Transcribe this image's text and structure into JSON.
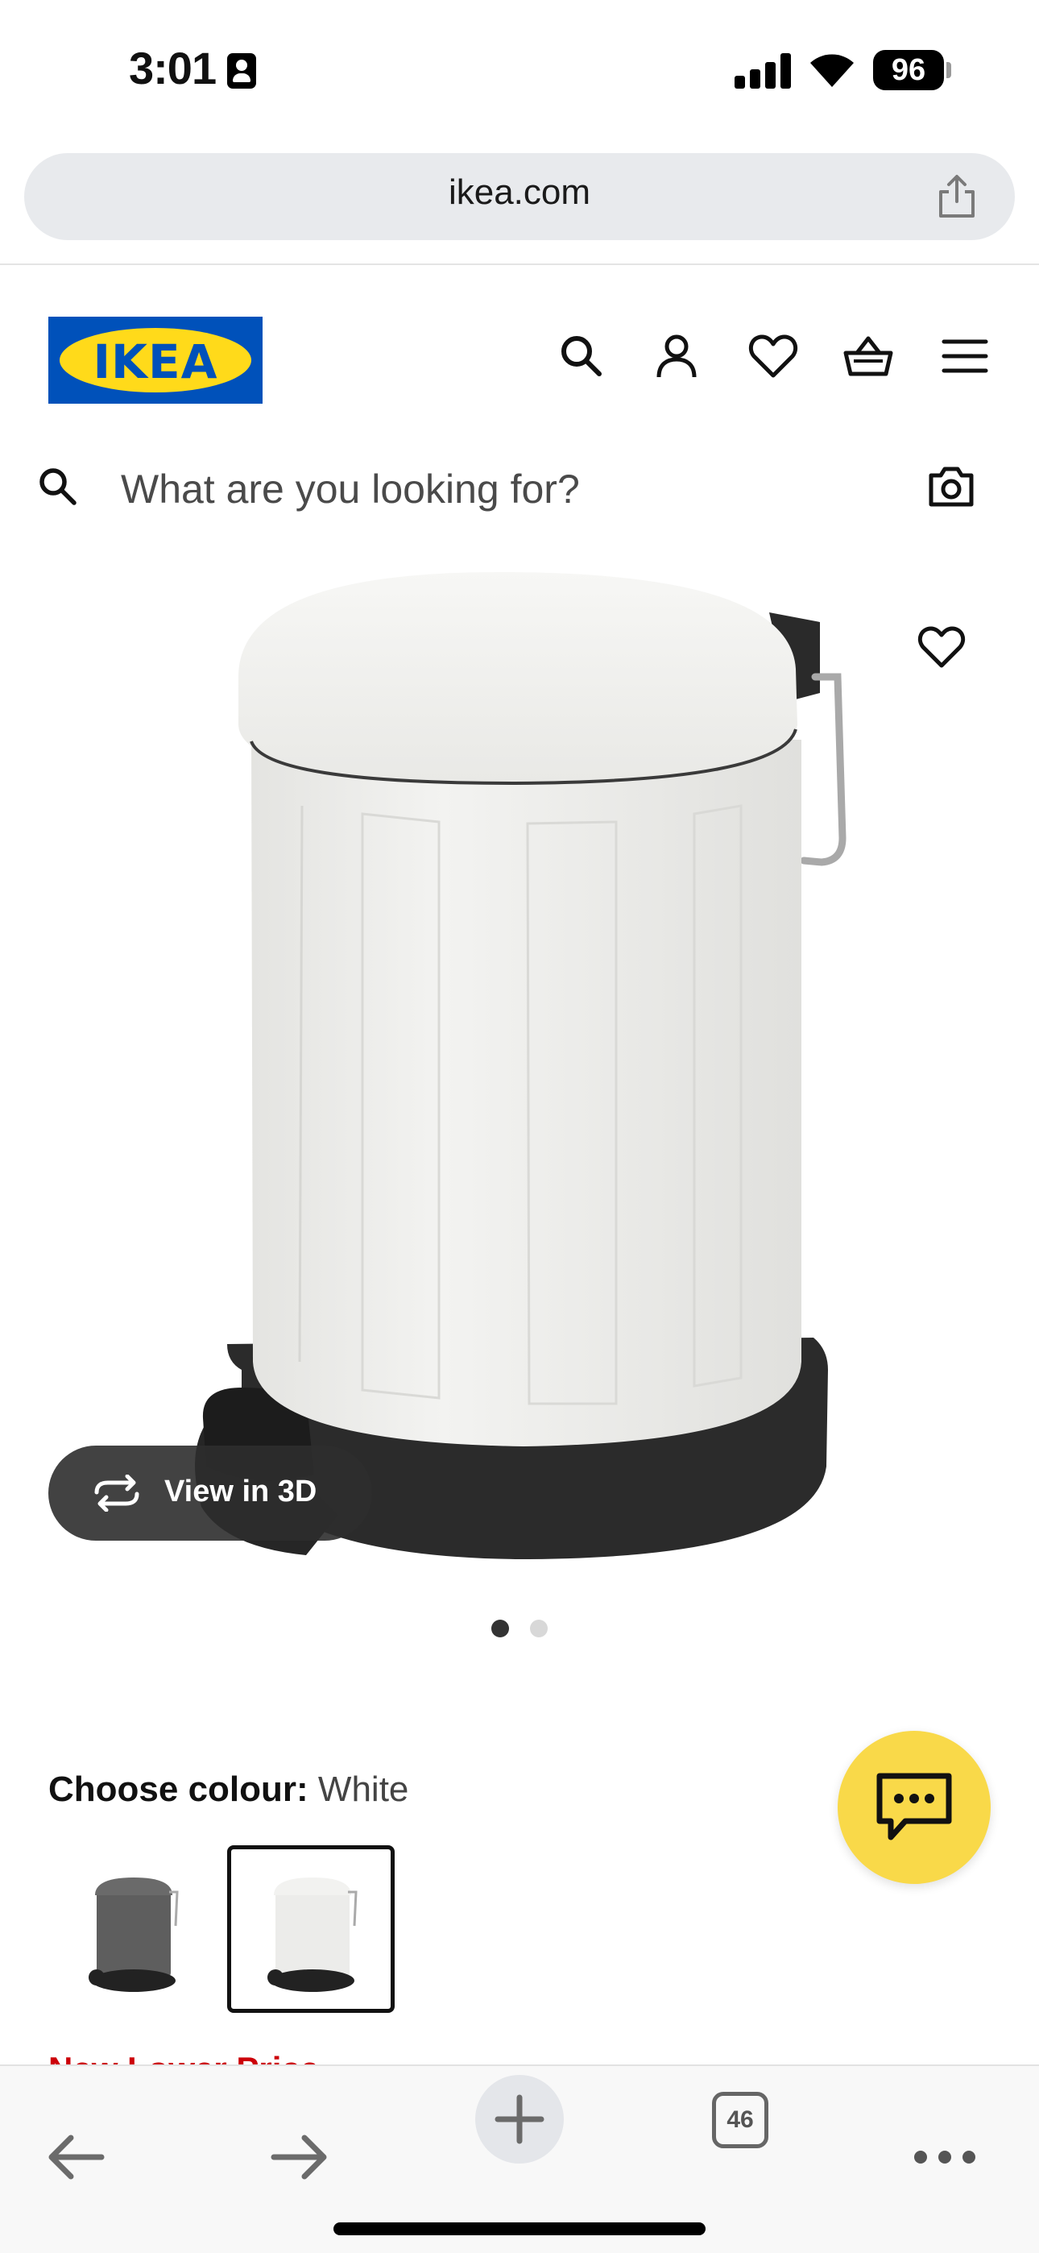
{
  "status_bar": {
    "time": "3:01",
    "battery": "96"
  },
  "browser": {
    "url": "ikea.com",
    "share_icon": "share-icon",
    "tabs_count": "46"
  },
  "site_header": {
    "logo": "IKEA",
    "logo_colors": {
      "blue": "#0051ba",
      "yellow": "#ffda1a"
    },
    "icons": [
      "search-icon",
      "account-icon",
      "heart-icon",
      "basket-icon",
      "menu-icon"
    ]
  },
  "search": {
    "placeholder": "What are you looking for?",
    "camera_icon": "camera-icon"
  },
  "product": {
    "view_3d_label": "View in 3D",
    "gallery_total": 2,
    "gallery_active": 1,
    "colour_label": "Choose colour:",
    "colour_value": "White",
    "swatches": [
      {
        "name": "Dark grey",
        "selected": false,
        "color": "#5b5b5b"
      },
      {
        "name": "White",
        "selected": true,
        "color": "#eeeeea"
      }
    ],
    "peek_text": "New Lower Price"
  },
  "chat": {
    "icon": "chat-icon",
    "color": "#f9d949"
  },
  "toolbar": {
    "items": [
      "back-icon",
      "forward-icon",
      "plus-icon",
      "tabs-icon",
      "more-icon"
    ]
  }
}
